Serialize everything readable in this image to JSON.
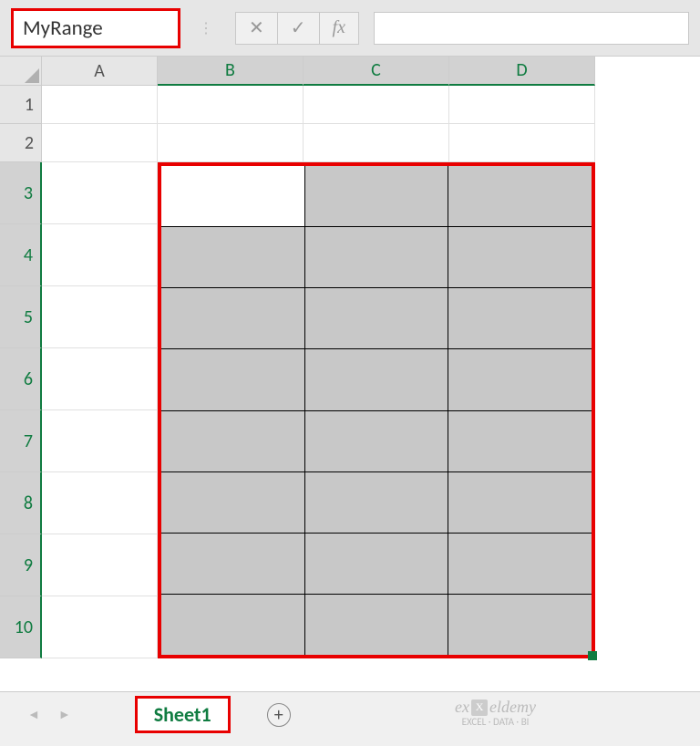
{
  "formula_bar": {
    "name_box_value": "MyRange",
    "fx_label": "fx",
    "cancel_symbol": "✕",
    "confirm_symbol": "✓",
    "formula_value": ""
  },
  "columns": [
    {
      "label": "A",
      "selected": false
    },
    {
      "label": "B",
      "selected": true
    },
    {
      "label": "C",
      "selected": true
    },
    {
      "label": "D",
      "selected": true
    }
  ],
  "rows": [
    {
      "label": "1",
      "selected": false
    },
    {
      "label": "2",
      "selected": false
    },
    {
      "label": "3",
      "selected": true
    },
    {
      "label": "4",
      "selected": true
    },
    {
      "label": "5",
      "selected": true
    },
    {
      "label": "6",
      "selected": true
    },
    {
      "label": "7",
      "selected": true
    },
    {
      "label": "8",
      "selected": true
    },
    {
      "label": "9",
      "selected": true
    },
    {
      "label": "10",
      "selected": true
    }
  ],
  "selection": {
    "named_range": "MyRange",
    "range": "B3:D10",
    "active_cell": "B3",
    "cols": 3,
    "rows": 8
  },
  "tabs": {
    "active_sheet": "Sheet1",
    "prev_symbol": "◄",
    "next_symbol": "►",
    "add_symbol": "+"
  },
  "watermark": {
    "brand1": "ex",
    "brand_icon": "X",
    "brand2": "eldemy",
    "tagline": "EXCEL · DATA · BI"
  }
}
